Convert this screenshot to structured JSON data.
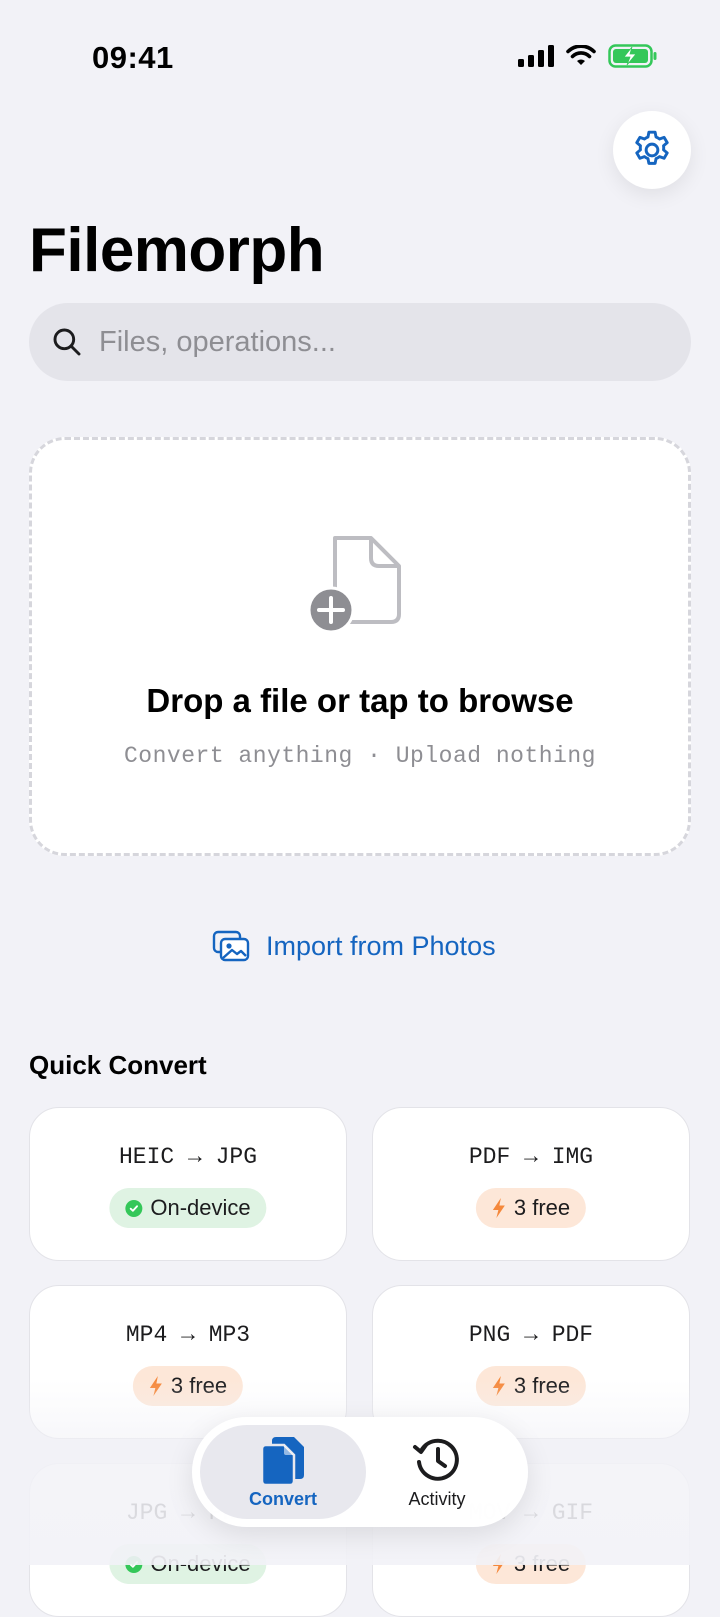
{
  "status_bar": {
    "time": "09:41"
  },
  "header": {
    "title": "Filemorph",
    "settings_icon": "gear-icon"
  },
  "search": {
    "placeholder": "Files, operations..."
  },
  "dropzone": {
    "title": "Drop a file or tap to browse",
    "subtitle": "Convert anything · Upload nothing"
  },
  "import": {
    "label": "Import from Photos",
    "icon": "photos-icon"
  },
  "quick_convert": {
    "title": "Quick Convert",
    "items": [
      {
        "label": "HEIC → JPG",
        "badge": "On-device",
        "badge_type": "on-device"
      },
      {
        "label": "PDF → IMG",
        "badge": "3 free",
        "badge_type": "free"
      },
      {
        "label": "MP4 → MP3",
        "badge": "3 free",
        "badge_type": "free"
      },
      {
        "label": "PNG → PDF",
        "badge": "3 free",
        "badge_type": "free"
      },
      {
        "label": "JPG → PNG",
        "badge": "On-device",
        "badge_type": "on-device"
      },
      {
        "label": "MOV → GIF",
        "badge": "3 free",
        "badge_type": "free"
      }
    ]
  },
  "tabbar": {
    "tabs": [
      {
        "label": "Convert",
        "icon": "documents-icon",
        "active": true
      },
      {
        "label": "Activity",
        "icon": "history-icon",
        "active": false
      }
    ]
  },
  "colors": {
    "accent": "#1565c0",
    "on_device_bg": "#dff3e3",
    "free_bg": "#fde7d8",
    "bolt": "#f5883b",
    "check": "#34c759"
  }
}
